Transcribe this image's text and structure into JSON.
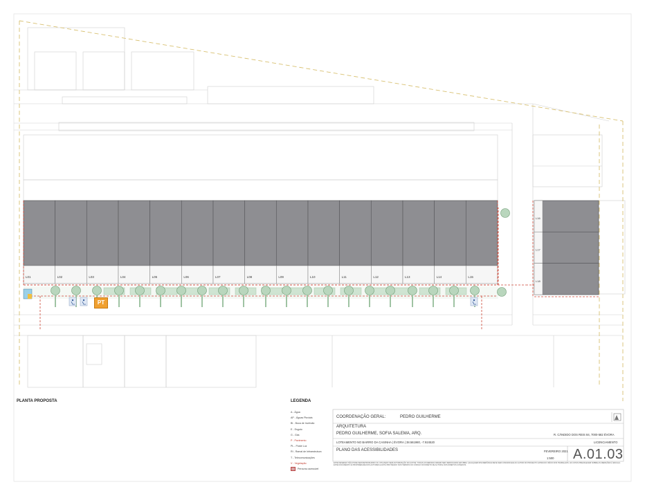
{
  "sheet": {
    "plan_title": "PLANTA PROPOSTA",
    "legend_title": "LEGENDA",
    "legend_items": [
      {
        "label": "A - Água",
        "color": "#444444"
      },
      {
        "label": "AP - Águas Pluviais",
        "color": "#444444"
      },
      {
        "label": "BI - Boca de Incêndio",
        "color": "#444444"
      },
      {
        "label": "E - Esgoto",
        "color": "#444444"
      },
      {
        "label": "G - Gás",
        "color": "#444444"
      },
      {
        "label": "P - Pavimento",
        "color": "#c0392b"
      },
      {
        "label": "PL - Poste Luz",
        "color": "#444444"
      },
      {
        "label": "RI - Ramal de Infraestrutura",
        "color": "#444444"
      },
      {
        "label": "T - Telecomunicações",
        "color": "#444444"
      },
      {
        "label": "V - Vegetação",
        "color": "#c0392b"
      },
      {
        "label": "Percurso acessível",
        "color": "#444444",
        "swatch": true
      }
    ],
    "lots_top": [
      "L01",
      "L02",
      "L03",
      "L04",
      "L05",
      "L06",
      "L07",
      "L08",
      "L09",
      "L10",
      "L11",
      "L12",
      "L13",
      "L14",
      "L15"
    ],
    "lots_right": [
      "L16",
      "L17",
      "L18"
    ],
    "pt_label": "PT",
    "title_block": {
      "coord_caption": "COORDENAÇÃO GERAL:",
      "coord_name": "PEDRO GUILHERME",
      "arch_caption": "ARQUITETURA",
      "arch_names": "PEDRO GUILHERME, SOFIA SALEMA, ARQ.",
      "address": "R. CÂNDIDO DOS REIS 84, 7000-582 ÉVORA",
      "project": "LOTEAMENTO NO BAIRRO DA CASINHA | ÉVORA | 38.561980, -7.924520",
      "phase": "LICENCIAMENTO",
      "drawing_title": "PLANO DAS ACESSIBILIDADES",
      "date": "FEVEREIRO 2021",
      "scale": "1:500",
      "drawing_number": "A.01.03"
    },
    "notes": "ESTE DESENHO NÃO PODE SER REPRODUZIDO OU UTILIZADO SEM AUTORIZAÇÃO DO AUTOR. TODAS AS MEDIDAS DEVEM SER VERIFICADAS EM OBRA. QUALQUER DISCREPÂNCIA DEVE SER COMUNICADA AO AUTOR DO PROJECTO ANTES DO INÍCIO DOS TRABALHOS. AS COTAS PREVALECEM SOBRE AS MEDIÇÕES À ESCALA. ESTE DOCUMENTO É PROPRIEDADE DOS AUTORES E ESTÁ PROTEGIDO NOS TERMOS DO CÓDIGO DO DIREITO DE AUTOR E DOS DIREITOS CONEXOS."
  }
}
